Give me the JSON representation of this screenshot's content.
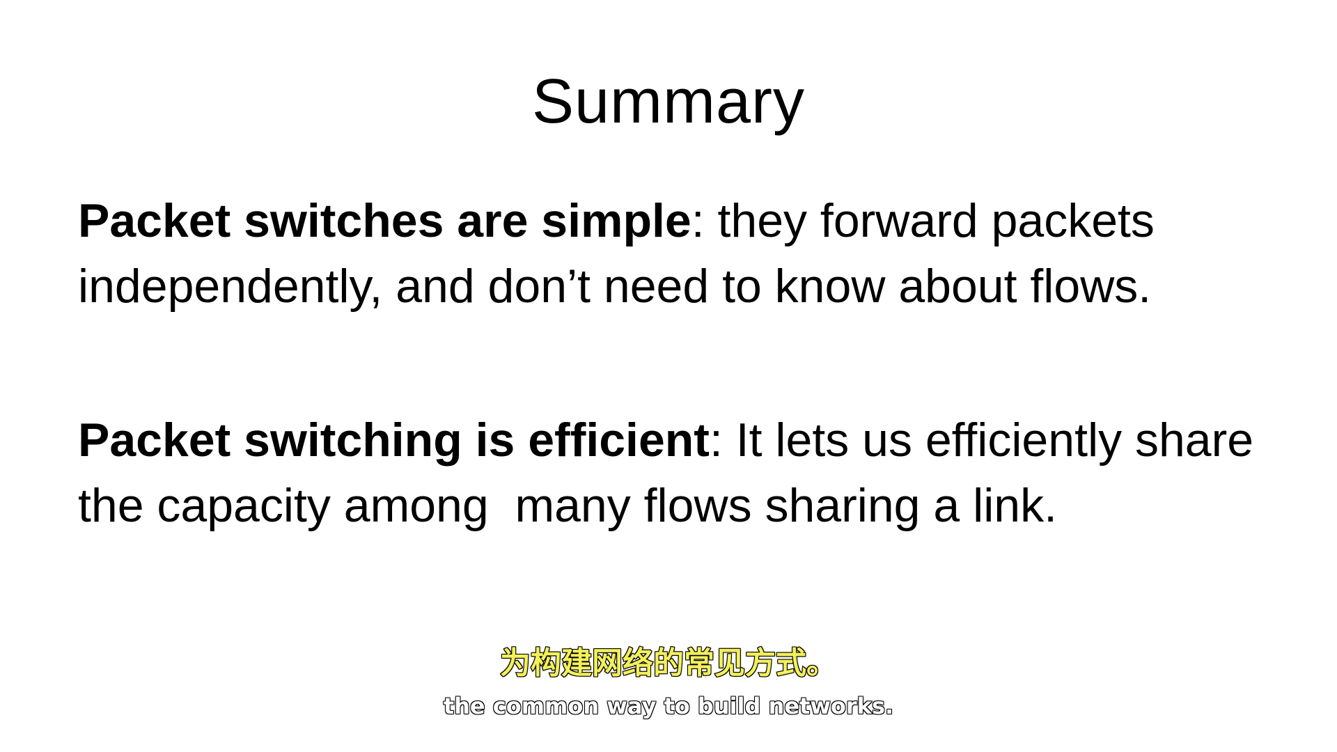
{
  "slide": {
    "title": "Summary",
    "points": [
      {
        "lead": "Packet switches are simple",
        "rest": ": they forward packets independently, and don’t need to know about flows."
      },
      {
        "lead": "Packet switching is efficient",
        "rest": ": It lets us efficiently share the capacity among  many flows sharing a link."
      }
    ]
  },
  "subtitles": {
    "chinese": "为构建网络的常见方式。",
    "english": "the common way to build networks."
  }
}
